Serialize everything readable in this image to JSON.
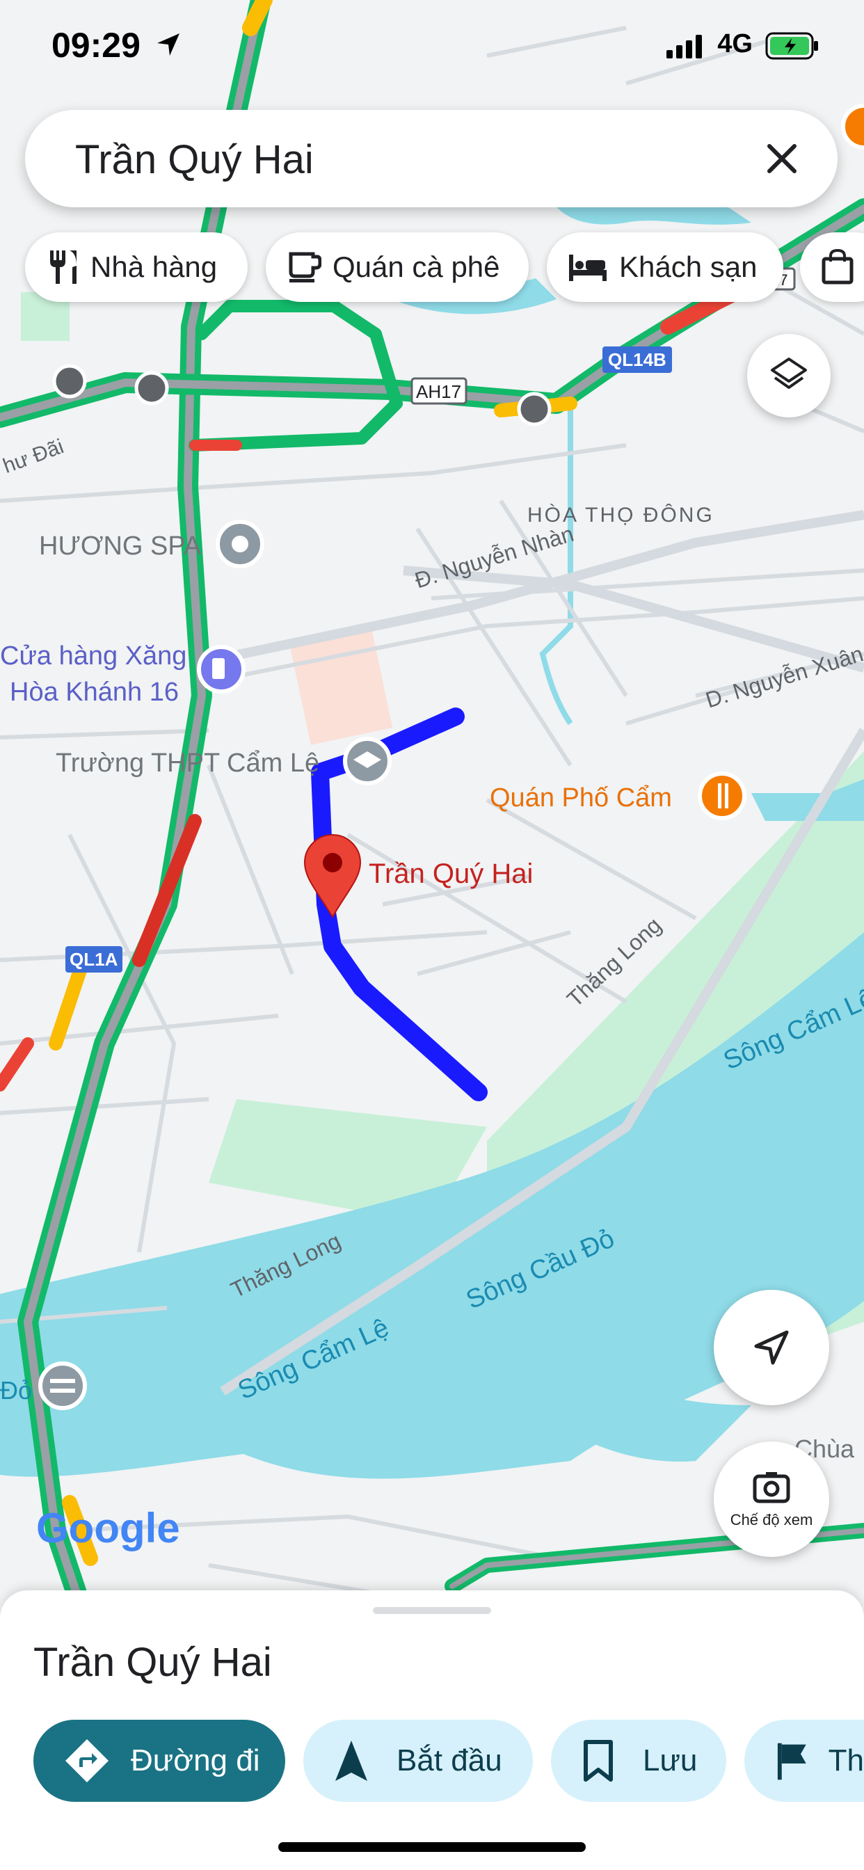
{
  "status_bar": {
    "time": "09:29",
    "network": "4G"
  },
  "search": {
    "query": "Trần Quý Hai"
  },
  "chips": [
    {
      "label": "Nhà hàng",
      "icon": "restaurant-icon"
    },
    {
      "label": "Quán cà phê",
      "icon": "coffee-icon"
    },
    {
      "label": "Khách sạn",
      "icon": "hotel-icon"
    },
    {
      "label": "",
      "icon": "shopping-bag-icon"
    }
  ],
  "map": {
    "places": {
      "huong_spa": "HƯƠNG SPA",
      "gas_line1": "Cửa hàng Xăng",
      "gas_line2": "Hòa Khánh 16",
      "school": "Trường THPT Cẩm Lệ",
      "selected": "Trần Quý Hai",
      "restaurant": "Quán Phố Cẩm",
      "pagoda": "Chùa",
      "ward": "HÒA THỌ ĐÔNG"
    },
    "roads": {
      "nguyen_nhan": "Đ. Nguyễn Nhàn",
      "nguyen_xuan": "D. Nguyễn Xuân",
      "thang_long_1": "Thăng Long",
      "thang_long_2": "Thăng Long",
      "chu_dai": "hư Đãi"
    },
    "rivers": {
      "cam_le_1": "Sông Cẩm Lệ",
      "cam_le_2": "Sông Cẩm Lệ",
      "cau_do": "Sông Cầu Đỏ",
      "do_fragment": "Đỏ"
    },
    "shields": {
      "ah17": "AH17",
      "ql14b": "QL14B",
      "ql1a": "QL1A",
      "ah17_partial": "17"
    },
    "brand": "Google"
  },
  "controls": {
    "layers_icon": "layers-icon",
    "locate_icon": "navigation-arrow-icon",
    "lens_label": "Chế độ xem"
  },
  "sheet": {
    "title": "Trần Quý Hai",
    "actions": [
      {
        "label": "Đường đi",
        "icon": "directions-icon"
      },
      {
        "label": "Bắt đầu",
        "icon": "navigation-icon"
      },
      {
        "label": "Lưu",
        "icon": "bookmark-icon"
      },
      {
        "label": "Th",
        "icon": "flag-icon"
      }
    ]
  },
  "colors": {
    "route": "#1a1aff",
    "traffic_green": "#1db954",
    "pin": "#ea4335",
    "water": "#8fdbe8",
    "park": "#c8f0d8",
    "primary": "#1a7384"
  }
}
